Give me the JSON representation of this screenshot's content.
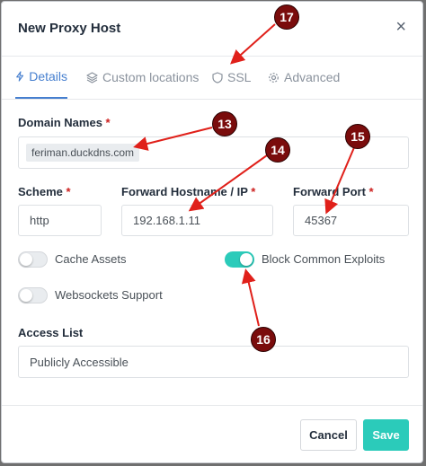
{
  "dialog": {
    "title": "New Proxy Host",
    "close_glyph": "×"
  },
  "tabs": [
    {
      "label": "Details",
      "icon": "bolt-icon",
      "active": true
    },
    {
      "label": "Custom locations",
      "icon": "layers-icon",
      "active": false
    },
    {
      "label": "SSL",
      "icon": "shield-icon",
      "active": false
    },
    {
      "label": "Advanced",
      "icon": "gear-icon",
      "active": false
    }
  ],
  "form": {
    "domain_names": {
      "label": "Domain Names",
      "required": "*",
      "value": "feriman.duckdns.com"
    },
    "scheme": {
      "label": "Scheme",
      "required": "*",
      "value": "http"
    },
    "forward_host": {
      "label": "Forward Hostname / IP",
      "required": "*",
      "value": "192.168.1.11"
    },
    "forward_port": {
      "label": "Forward Port",
      "required": "*",
      "value": "45367"
    },
    "toggles": [
      {
        "label": "Cache Assets",
        "on": false
      },
      {
        "label": "Block Common Exploits",
        "on": true
      },
      {
        "label": "Websockets Support",
        "on": false
      }
    ],
    "access_list": {
      "label": "Access List",
      "value": "Publicly Accessible"
    }
  },
  "footer": {
    "cancel_label": "Cancel",
    "save_label": "Save"
  },
  "annotations": [
    "17",
    "13",
    "14",
    "15",
    "16"
  ],
  "colors": {
    "accent": "#467fcf",
    "teal": "#2bcbba",
    "marker": "#7a0c0c",
    "arrow": "#e0201a"
  }
}
